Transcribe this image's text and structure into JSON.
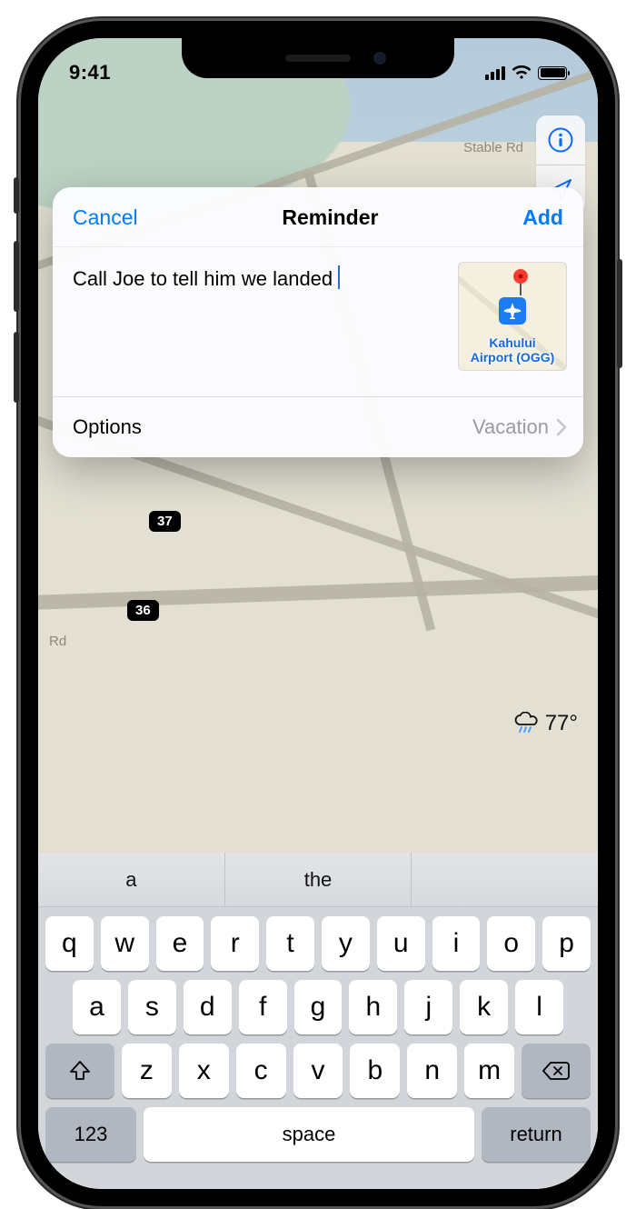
{
  "statusbar": {
    "time": "9:41"
  },
  "map": {
    "road_label": "Stable Rd",
    "left_road_label": "Rd",
    "shields": [
      "37",
      "36"
    ],
    "weather_temp": "77°",
    "info_icon": "info-icon",
    "locate_icon": "location-arrow-icon"
  },
  "popover": {
    "cancel": "Cancel",
    "title": "Reminder",
    "add": "Add",
    "reminder_text": "Call Joe to tell him we landed",
    "location_name": "Kahului\nAirport (OGG)",
    "options_label": "Options",
    "options_value": "Vacation"
  },
  "keyboard": {
    "predictions": [
      "a",
      "the",
      ""
    ],
    "row1": [
      "q",
      "w",
      "e",
      "r",
      "t",
      "y",
      "u",
      "i",
      "o",
      "p"
    ],
    "row2": [
      "a",
      "s",
      "d",
      "f",
      "g",
      "h",
      "j",
      "k",
      "l"
    ],
    "row3": [
      "z",
      "x",
      "c",
      "v",
      "b",
      "n",
      "m"
    ],
    "numkey": "123",
    "space": "space",
    "return": "return"
  }
}
